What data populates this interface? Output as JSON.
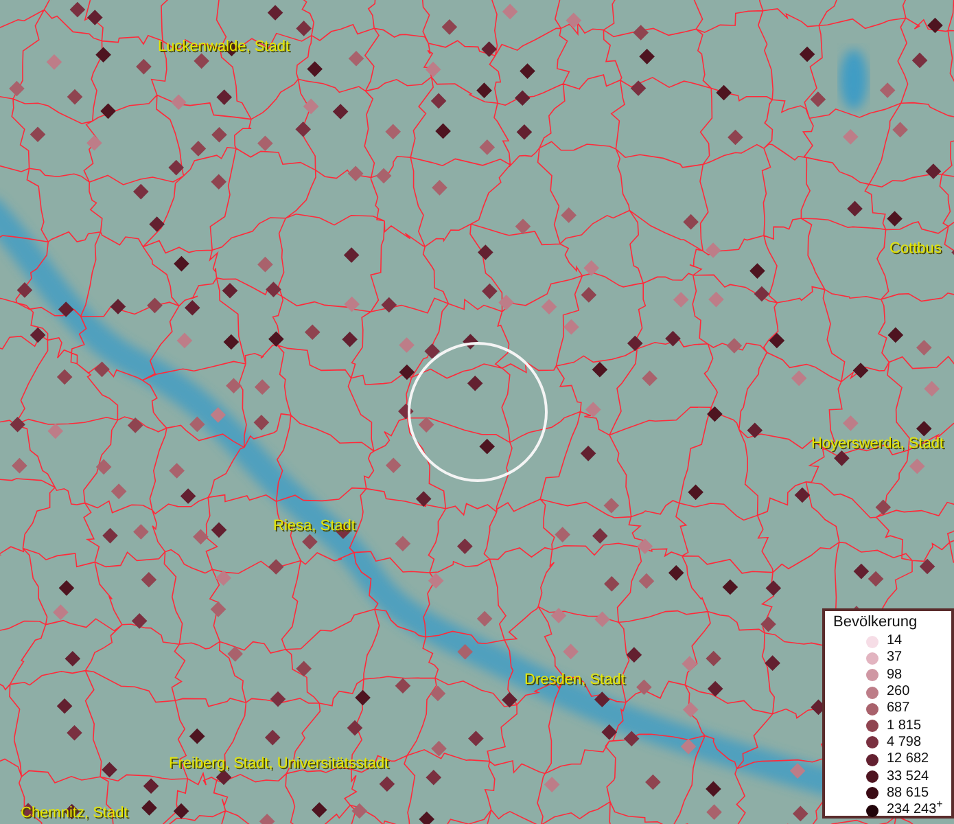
{
  "map": {
    "city_labels": [
      "Luckenwalde, Stadt",
      "Cottbus",
      "Hoyerswerda, Stadt",
      "Riesa, Stadt",
      "Dresden, Stadt",
      "Freiberg, Stadt, Universitätsstadt",
      "Chemnitz, Stadt"
    ]
  },
  "legend": {
    "title": "Bevölkerung",
    "items": [
      {
        "label": "14",
        "color": "#f6dde6"
      },
      {
        "label": "37",
        "color": "#e2b4c0"
      },
      {
        "label": "98",
        "color": "#cf97a3"
      },
      {
        "label": "260",
        "color": "#bd7d88"
      },
      {
        "label": "687",
        "color": "#a9626c"
      },
      {
        "label": "1 815",
        "color": "#8f4450"
      },
      {
        "label": "4 798",
        "color": "#7a3040"
      },
      {
        "label": "12 682",
        "color": "#632030"
      },
      {
        "label": "33 524",
        "color": "#4e1420"
      },
      {
        "label": "88 615",
        "color": "#3a0a14"
      },
      {
        "label": "234 243$^{+}$",
        "color": "#22040a"
      }
    ]
  }
}
